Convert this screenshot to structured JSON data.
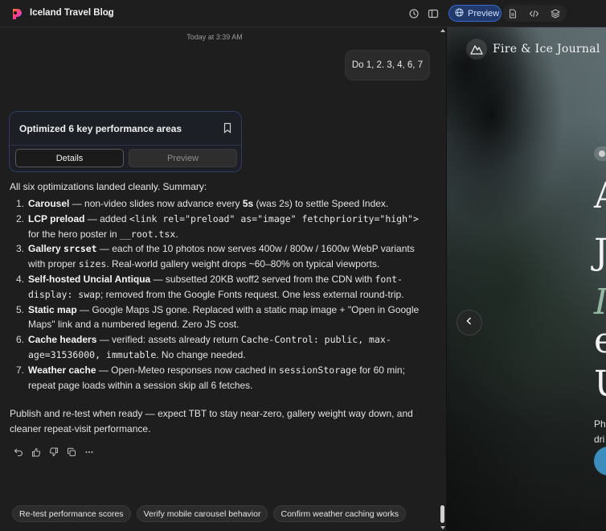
{
  "header": {
    "project_title": "Iceland Travel Blog",
    "icons": [
      "app-logo-icon",
      "chevron-down-icon",
      "history-icon",
      "sidebar-toggle-icon",
      "globe-icon",
      "file-icon",
      "code-icon",
      "layers-icon"
    ],
    "preview_tab_label": "Preview",
    "accent_color": "#3b6ad8"
  },
  "chat": {
    "timestamp": "Today at 3:39 AM",
    "user_message": "Do 1, 2. 3, 4, 6, 7",
    "card": {
      "title": "Optimized 6 key performance areas",
      "details_label": "Details",
      "preview_label": "Preview"
    },
    "summary": "All six optimizations landed cleanly. Summary:",
    "items": [
      {
        "n": "1.",
        "parts": [
          {
            "t": "Carousel",
            "s": "b"
          },
          {
            "t": " — non-video slides now advance every ",
            "s": ""
          },
          {
            "t": "5s",
            "s": "b"
          },
          {
            "t": " (was 2s) to settle Speed Index.",
            "s": ""
          }
        ]
      },
      {
        "n": "2.",
        "parts": [
          {
            "t": "LCP preload",
            "s": "b"
          },
          {
            "t": " — added ",
            "s": ""
          },
          {
            "t": "<link rel=\"preload\" as=\"image\" fetchpriority=\"high\">",
            "s": "c"
          },
          {
            "t": " for the hero poster in ",
            "s": ""
          },
          {
            "t": "__root.tsx",
            "s": "c"
          },
          {
            "t": ".",
            "s": ""
          }
        ]
      },
      {
        "n": "3.",
        "parts": [
          {
            "t": "Gallery",
            "s": "b"
          },
          {
            "t": " ",
            "s": ""
          },
          {
            "t": "srcset",
            "s": "bc"
          },
          {
            "t": " — each of the 10 photos now serves 400w / 800w / 1600w WebP variants with proper ",
            "s": ""
          },
          {
            "t": "sizes",
            "s": "c"
          },
          {
            "t": ". Real-world gallery weight drops ~60–80% on typical viewports.",
            "s": ""
          }
        ]
      },
      {
        "n": "4.",
        "parts": [
          {
            "t": "Self-hosted Uncial Antiqua",
            "s": "b"
          },
          {
            "t": " — subsetted 20KB woff2 served from the CDN with ",
            "s": ""
          },
          {
            "t": "font-display: swap",
            "s": "c"
          },
          {
            "t": "; removed from the Google Fonts request. One less external round-trip.",
            "s": ""
          }
        ]
      },
      {
        "n": "5.",
        "parts": [
          {
            "t": "Static map",
            "s": "b"
          },
          {
            "t": " — Google Maps JS gone. Replaced with a static map image + \"Open in Google Maps\" link and a numbered legend. Zero JS cost.",
            "s": ""
          }
        ]
      },
      {
        "n": "6.",
        "parts": [
          {
            "t": "Cache headers",
            "s": "b"
          },
          {
            "t": " — verified: assets already return ",
            "s": ""
          },
          {
            "t": "Cache-Control: public, max-age=31536000, immutable",
            "s": "c"
          },
          {
            "t": ". No change needed.",
            "s": ""
          }
        ]
      },
      {
        "n": "7.",
        "parts": [
          {
            "t": "Weather cache",
            "s": "b"
          },
          {
            "t": " — Open-Meteo responses now cached in ",
            "s": ""
          },
          {
            "t": "sessionStorage",
            "s": "c"
          },
          {
            "t": " for 60 min; repeat page loads within a session skip all 6 fetches.",
            "s": ""
          }
        ]
      }
    ],
    "closing": "Publish and re-test when ready — expect TBT to stay near-zero, gallery weight way down, and cleaner repeat-visit performance.",
    "action_icons": [
      "undo-icon",
      "thumbs-up-icon",
      "thumbs-down-icon",
      "copy-icon",
      "more-icon"
    ],
    "suggestions": [
      "Re-test performance scores",
      "Verify mobile carousel behavior",
      "Confirm weather caching works"
    ]
  },
  "preview_site": {
    "site_name": "Fire & Ice Journal",
    "hero_chars": [
      "A",
      "J",
      "I",
      "e",
      "U"
    ],
    "hero_subtitle": "Ph\ndri",
    "cta_color": "#3b8dbb"
  }
}
